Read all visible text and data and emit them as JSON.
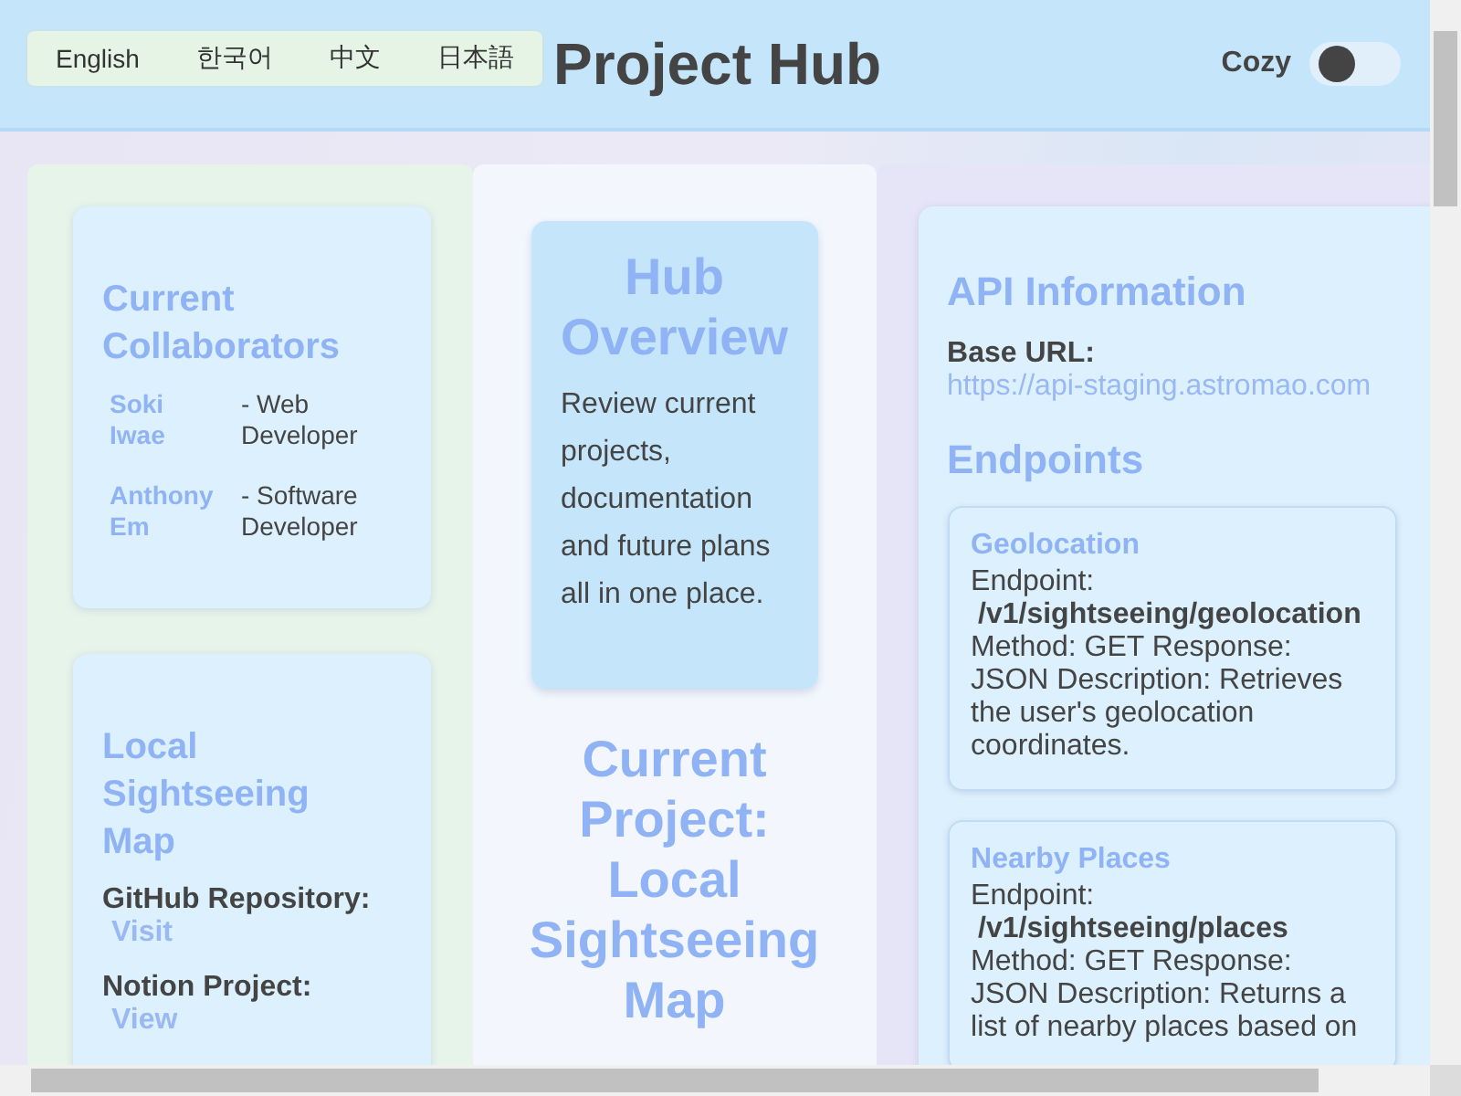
{
  "languages": [
    {
      "label": "English"
    },
    {
      "label": "한국어"
    },
    {
      "label": "中文"
    },
    {
      "label": "日本語"
    }
  ],
  "title": "Project Hub",
  "density_toggle": {
    "label": "Cozy",
    "on": false
  },
  "collaborators_card": {
    "title": "Current Collaborators",
    "people": [
      {
        "name": "Soki Iwae",
        "role": "- Web Developer"
      },
      {
        "name": "Anthony Em",
        "role": "- Software Developer"
      }
    ]
  },
  "project_card": {
    "title": "Local Sightseeing Map",
    "links": [
      {
        "label": "GitHub Repository:",
        "link": "Visit"
      },
      {
        "label": "Notion Project:",
        "link": "View"
      }
    ]
  },
  "overview": {
    "title": "Hub Overview",
    "text": "Review current projects, documentation and future plans all in one place."
  },
  "current_project": "Current Project: Local Sightseeing Map",
  "api": {
    "title": "API Information",
    "base_url_label": "Base URL:",
    "base_url": "https://api-staging.astromao.com",
    "endpoints_title": "Endpoints",
    "endpoints": [
      {
        "name": "Geolocation",
        "endpoint_label": "Endpoint:",
        "path": "/v1/sightseeing/geolocation",
        "details": "Method: GET Response: JSON Description: Retrieves the user's geolocation coordinates."
      },
      {
        "name": "Nearby Places",
        "endpoint_label": "Endpoint:",
        "path": "/v1/sightseeing/places",
        "details": "Method: GET Response: JSON Description: Returns a list of nearby places based on"
      }
    ]
  }
}
